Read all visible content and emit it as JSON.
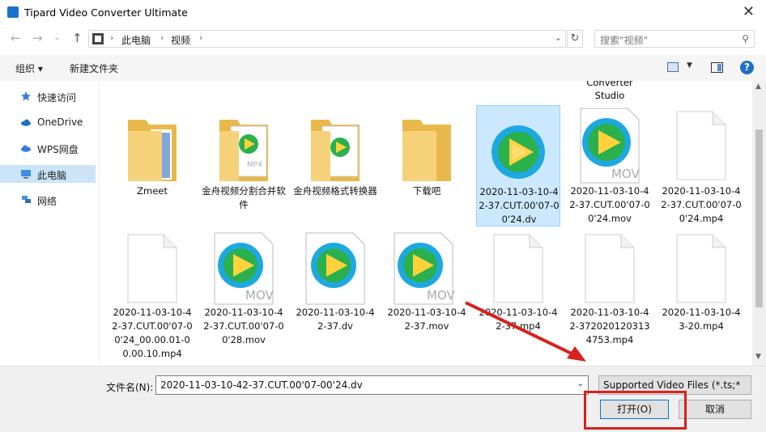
{
  "window": {
    "title": "Tipard Video Converter Ultimate",
    "close_symbol": "✕"
  },
  "nav": {
    "back_symbol": "←",
    "forward_symbol": "→",
    "recent_symbol": "⌄",
    "up_symbol": "↑",
    "breadcrumbs": [
      "此电脑",
      "视频"
    ],
    "separator": "›",
    "dropdown_symbol": "⌄",
    "refresh_symbol": "↻",
    "search_placeholder": "搜索\"视频\"",
    "search_symbol": "⚲"
  },
  "toolbar": {
    "organize": "组织 ▾",
    "new_folder": "新建文件夹",
    "view_dd": "▼",
    "help": "?"
  },
  "sidebar": {
    "items": [
      {
        "label": "快速访问",
        "icon": "star-icon",
        "color": "#3b82d6"
      },
      {
        "label": "OneDrive",
        "icon": "cloud-icon",
        "color": "#1f6fc9"
      },
      {
        "label": "WPS网盘",
        "icon": "cloud-icon",
        "color": "#3a7bd5"
      },
      {
        "label": "此电脑",
        "icon": "computer-icon",
        "color": "#3d8ee0",
        "selected": true
      },
      {
        "label": "网络",
        "icon": "network-icon",
        "color": "#4a90d9"
      }
    ]
  },
  "overflow_label": "Converter\nStudio",
  "files": [
    {
      "label": "Zmeet",
      "kind": "folder"
    },
    {
      "label": "金舟视频分割合并软件",
      "kind": "folder-video-mp4"
    },
    {
      "label": "金舟视频格式转换器",
      "kind": "folder-video"
    },
    {
      "label": "下载吧",
      "kind": "folder"
    },
    {
      "label": "2020-11-03-10-42-37.CUT.00'07-00'24.dv",
      "kind": "video",
      "selected": true
    },
    {
      "label": "2020-11-03-10-42-37.CUT.00'07-00'24.mov",
      "kind": "video-mov"
    },
    {
      "label": "2020-11-03-10-42-37.CUT.00'07-00'24.mp4",
      "kind": "blank"
    },
    {
      "label": "2020-11-03-10-42-37.CUT.00'07-00'24_00.00.01-00.00.10.mp4",
      "kind": "blank"
    },
    {
      "label": "2020-11-03-10-42-37.CUT.00'07-00'28.mov",
      "kind": "video-mov"
    },
    {
      "label": "2020-11-03-10-42-37.dv",
      "kind": "video"
    },
    {
      "label": "2020-11-03-10-42-37.mov",
      "kind": "video-mov"
    },
    {
      "label": "2020-11-03-10-42-37.mp4",
      "kind": "blank"
    },
    {
      "label": "2020-11-03-10-42-3720201203134753.mp4",
      "kind": "blank"
    },
    {
      "label": "2020-11-03-10-43-20.mp4",
      "kind": "blank"
    }
  ],
  "bottom": {
    "filename_label": "文件名(N):",
    "filename_value": "2020-11-03-10-42-37.CUT.00'07-00'24.dv",
    "filter_value": "Supported Video Files (*.ts;*",
    "open_label": "打开(O)",
    "cancel_label": "取消",
    "dropdown_symbol": "⌄",
    "scroll_up": "▲",
    "scroll_down": "▼"
  },
  "colors": {
    "accent": "#0078d7",
    "highlight_red": "#d9201c",
    "selection": "#cce8ff"
  }
}
